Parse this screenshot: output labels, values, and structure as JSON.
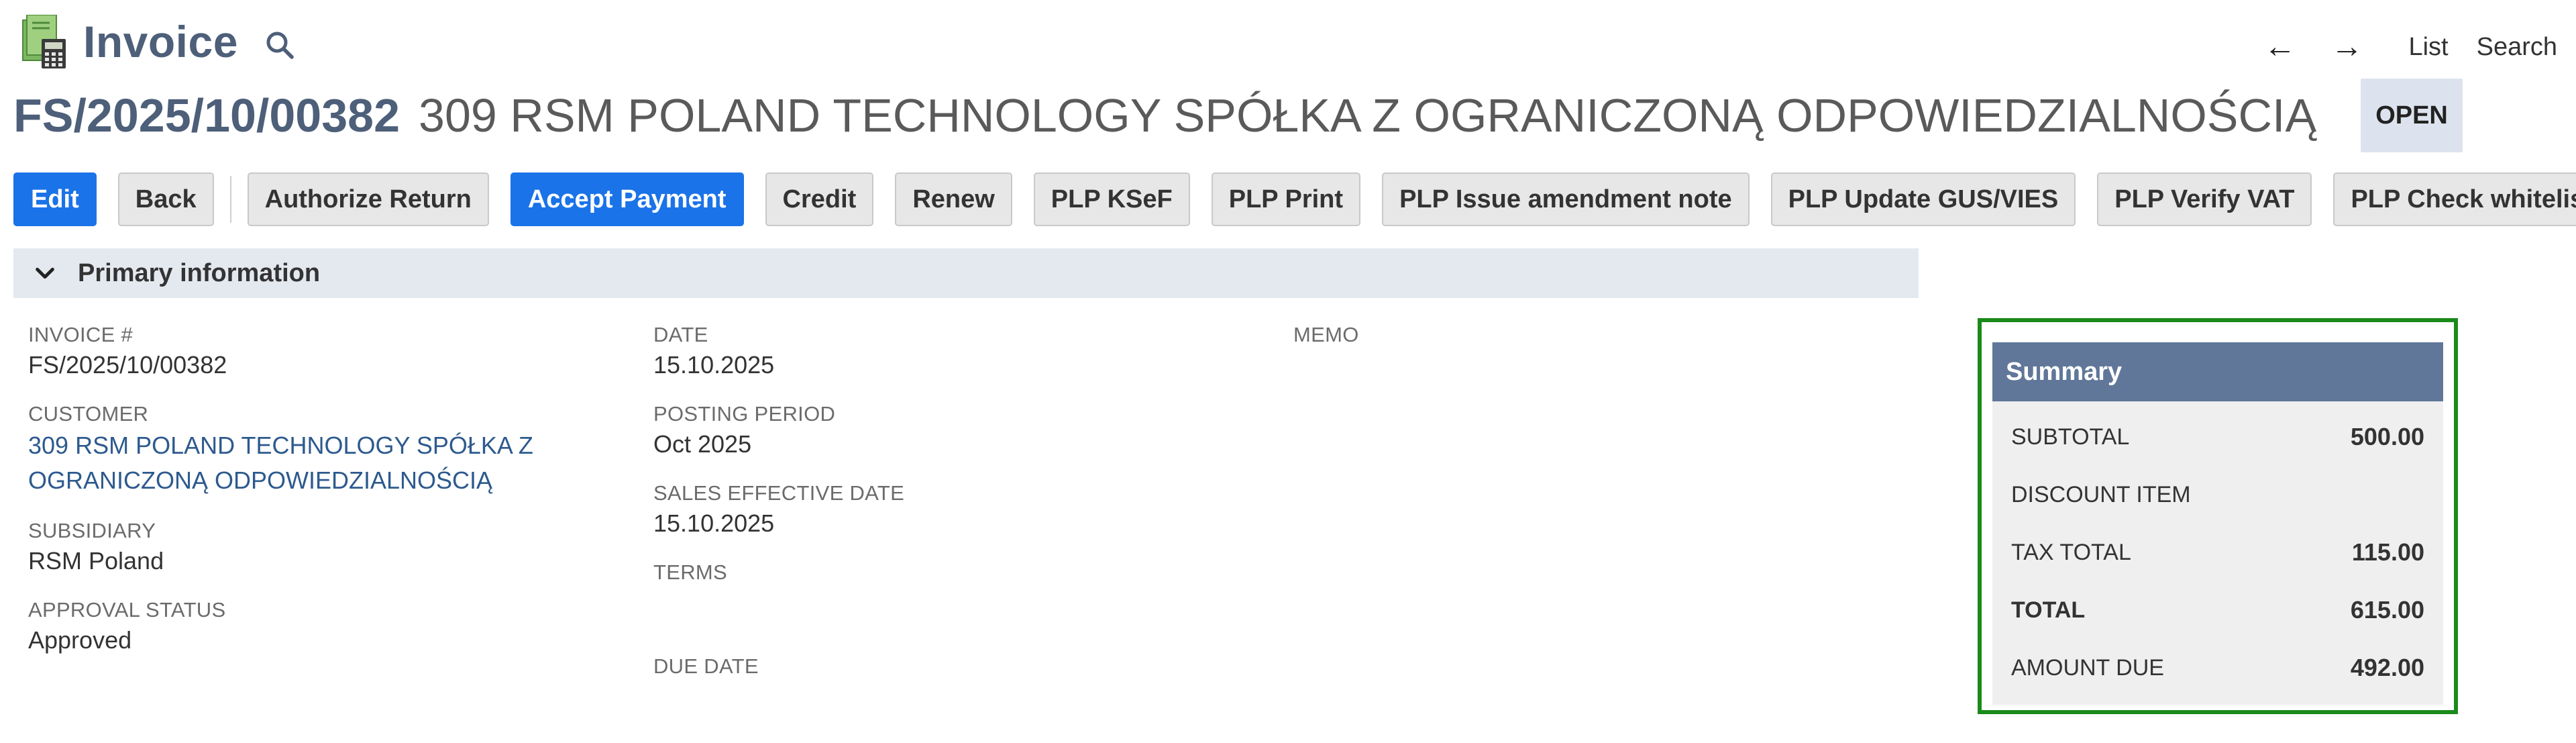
{
  "header": {
    "page_kind": "Invoice",
    "record_id": "FS/2025/10/00382",
    "record_name": "309 RSM POLAND TECHNOLOGY SPÓŁKA Z OGRANICZONĄ ODPOWIEDZIALNOŚCIĄ",
    "status": "OPEN",
    "icons": {
      "record_type": "invoice-calculator-icon",
      "search": "search-icon"
    }
  },
  "top_nav": {
    "back_arrow": "←",
    "forward_arrow": "→",
    "list_label": "List",
    "search_label": "Search"
  },
  "buttons": [
    {
      "label": "Edit",
      "primary": true
    },
    {
      "label": "Back",
      "primary": false
    },
    {
      "label": "Authorize Return",
      "primary": false
    },
    {
      "label": "Accept Payment",
      "primary": true
    },
    {
      "label": "Credit",
      "primary": false
    },
    {
      "label": "Renew",
      "primary": false
    },
    {
      "label": "PLP KSeF",
      "primary": false
    },
    {
      "label": "PLP Print",
      "primary": false
    },
    {
      "label": "PLP Issue amendment note",
      "primary": false
    },
    {
      "label": "PLP Update GUS/VIES",
      "primary": false
    },
    {
      "label": "PLP Verify VAT",
      "primary": false
    },
    {
      "label": "PLP Check whitelist",
      "primary": false
    }
  ],
  "section": {
    "title": "Primary information",
    "expanded": true
  },
  "fields": {
    "col1": [
      {
        "label": "INVOICE #",
        "value": "FS/2025/10/00382"
      },
      {
        "label": "CUSTOMER",
        "value": "309 RSM POLAND TECHNOLOGY SPÓŁKA Z OGRANICZONĄ ODPOWIEDZIALNOŚCIĄ"
      },
      {
        "label": "SUBSIDIARY",
        "value": "RSM Poland"
      },
      {
        "label": "APPROVAL STATUS",
        "value": "Approved"
      }
    ],
    "col2": [
      {
        "label": "DATE",
        "value": "15.10.2025"
      },
      {
        "label": "POSTING PERIOD",
        "value": "Oct 2025"
      },
      {
        "label": "SALES EFFECTIVE DATE",
        "value": "15.10.2025"
      },
      {
        "label": "TERMS",
        "value": ""
      },
      {
        "label": "DUE DATE",
        "value": ""
      }
    ],
    "col3": [
      {
        "label": "MEMO",
        "value": ""
      }
    ]
  },
  "summary": {
    "title": "Summary",
    "rows": [
      {
        "label": "SUBTOTAL",
        "value": "500.00"
      },
      {
        "label": "DISCOUNT ITEM",
        "value": ""
      },
      {
        "label": "TAX TOTAL",
        "value": "115.00"
      },
      {
        "label": "TOTAL",
        "value": "615.00"
      },
      {
        "label": "AMOUNT DUE",
        "value": "492.00"
      }
    ]
  },
  "colors": {
    "title": "#4d5f79",
    "primary_button": "#1a73e8",
    "section_header_bg": "#e4e8ef",
    "summary_header_bg": "#607799",
    "summary_border": "#1a8a1a",
    "link": "#2d5a8e"
  }
}
